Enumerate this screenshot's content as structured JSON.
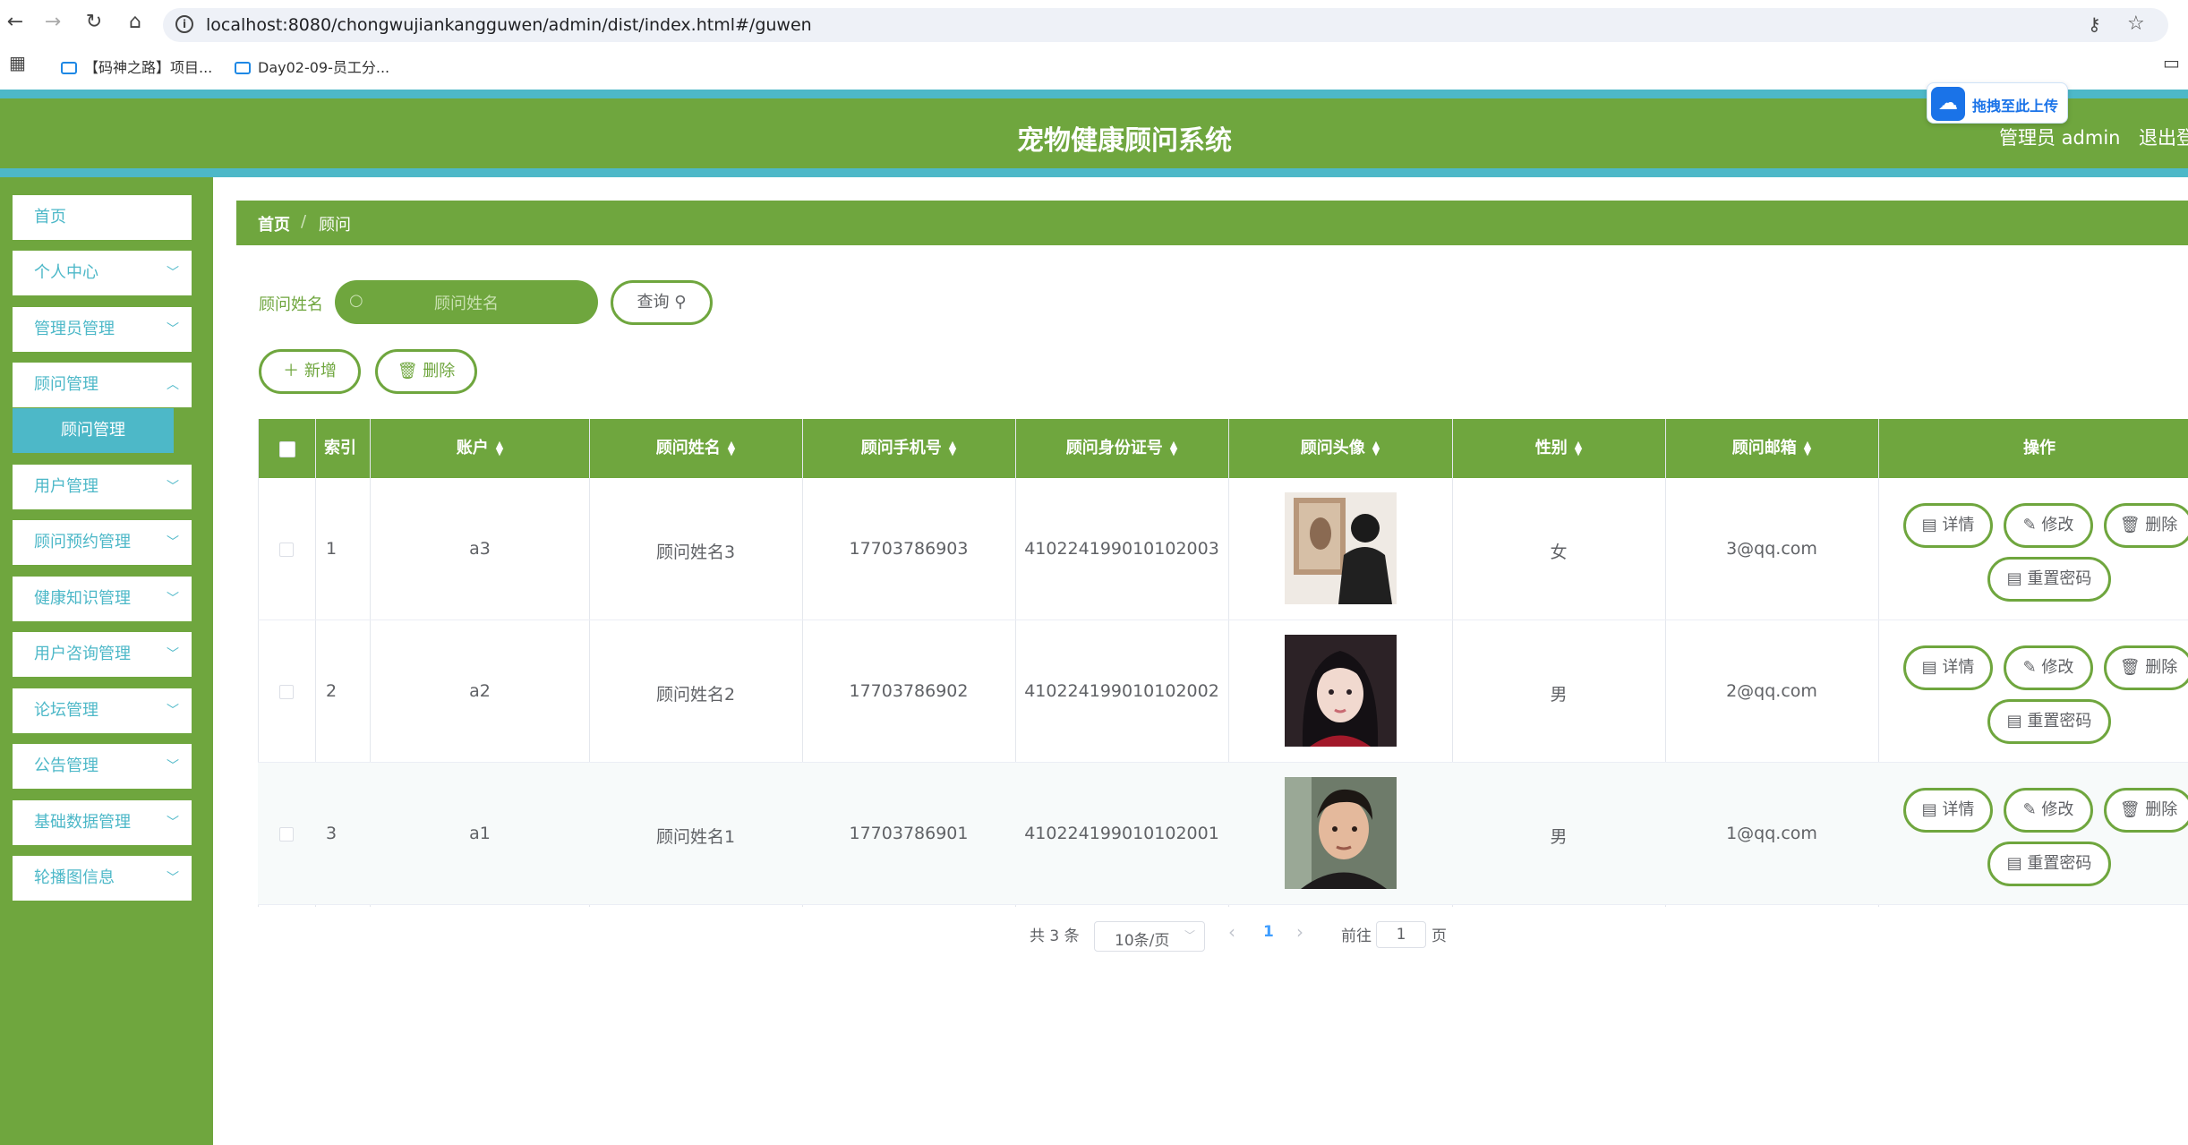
{
  "browser": {
    "url": "localhost:8080/chongwujiankangguwen/admin/dist/index.html#/guwen",
    "bookmarks": [
      "【码神之路】项目...",
      "Day02-09-员工分..."
    ]
  },
  "header": {
    "title": "宠物健康顾问系统",
    "user": "管理员 admin",
    "logout": "退出登",
    "upload_badge": "拖拽至此上传"
  },
  "sidebar": {
    "items": [
      {
        "label": "首页"
      },
      {
        "label": "个人中心"
      },
      {
        "label": "管理员管理"
      },
      {
        "label": "顾问管理"
      },
      {
        "label": "用户管理"
      },
      {
        "label": "顾问预约管理"
      },
      {
        "label": "健康知识管理"
      },
      {
        "label": "用户咨询管理"
      },
      {
        "label": "论坛管理"
      },
      {
        "label": "公告管理"
      },
      {
        "label": "基础数据管理"
      },
      {
        "label": "轮播图信息"
      }
    ],
    "active_sub": "顾问管理"
  },
  "breadcrumb": {
    "home": "首页",
    "sep": "/",
    "current": "顾问"
  },
  "search": {
    "label": "顾问姓名",
    "placeholder": "顾问姓名",
    "button": "查询"
  },
  "toolbar": {
    "add": "新增",
    "delete": "删除"
  },
  "table": {
    "columns": [
      "索引",
      "账户",
      "顾问姓名",
      "顾问手机号",
      "顾问身份证号",
      "顾问头像",
      "性别",
      "顾问邮箱",
      "操作"
    ],
    "rows": [
      {
        "index": "1",
        "account": "a3",
        "name": "顾问姓名3",
        "phone": "17703786903",
        "id_card": "410224199010102003",
        "gender": "女",
        "email": "3@qq.com"
      },
      {
        "index": "2",
        "account": "a2",
        "name": "顾问姓名2",
        "phone": "17703786902",
        "id_card": "410224199010102002",
        "gender": "男",
        "email": "2@qq.com"
      },
      {
        "index": "3",
        "account": "a1",
        "name": "顾问姓名1",
        "phone": "17703786901",
        "id_card": "410224199010102001",
        "gender": "男",
        "email": "1@qq.com"
      }
    ],
    "actions": {
      "detail": "详情",
      "edit": "修改",
      "delete": "删除",
      "reset": "重置密码"
    }
  },
  "pagination": {
    "total": "共 3 条",
    "page_size": "10条/页",
    "current": "1",
    "goto": "前往",
    "goto_value": "1",
    "page_unit": "页"
  },
  "colors": {
    "primary": "#6fa63e",
    "accent": "#4db8c8"
  }
}
